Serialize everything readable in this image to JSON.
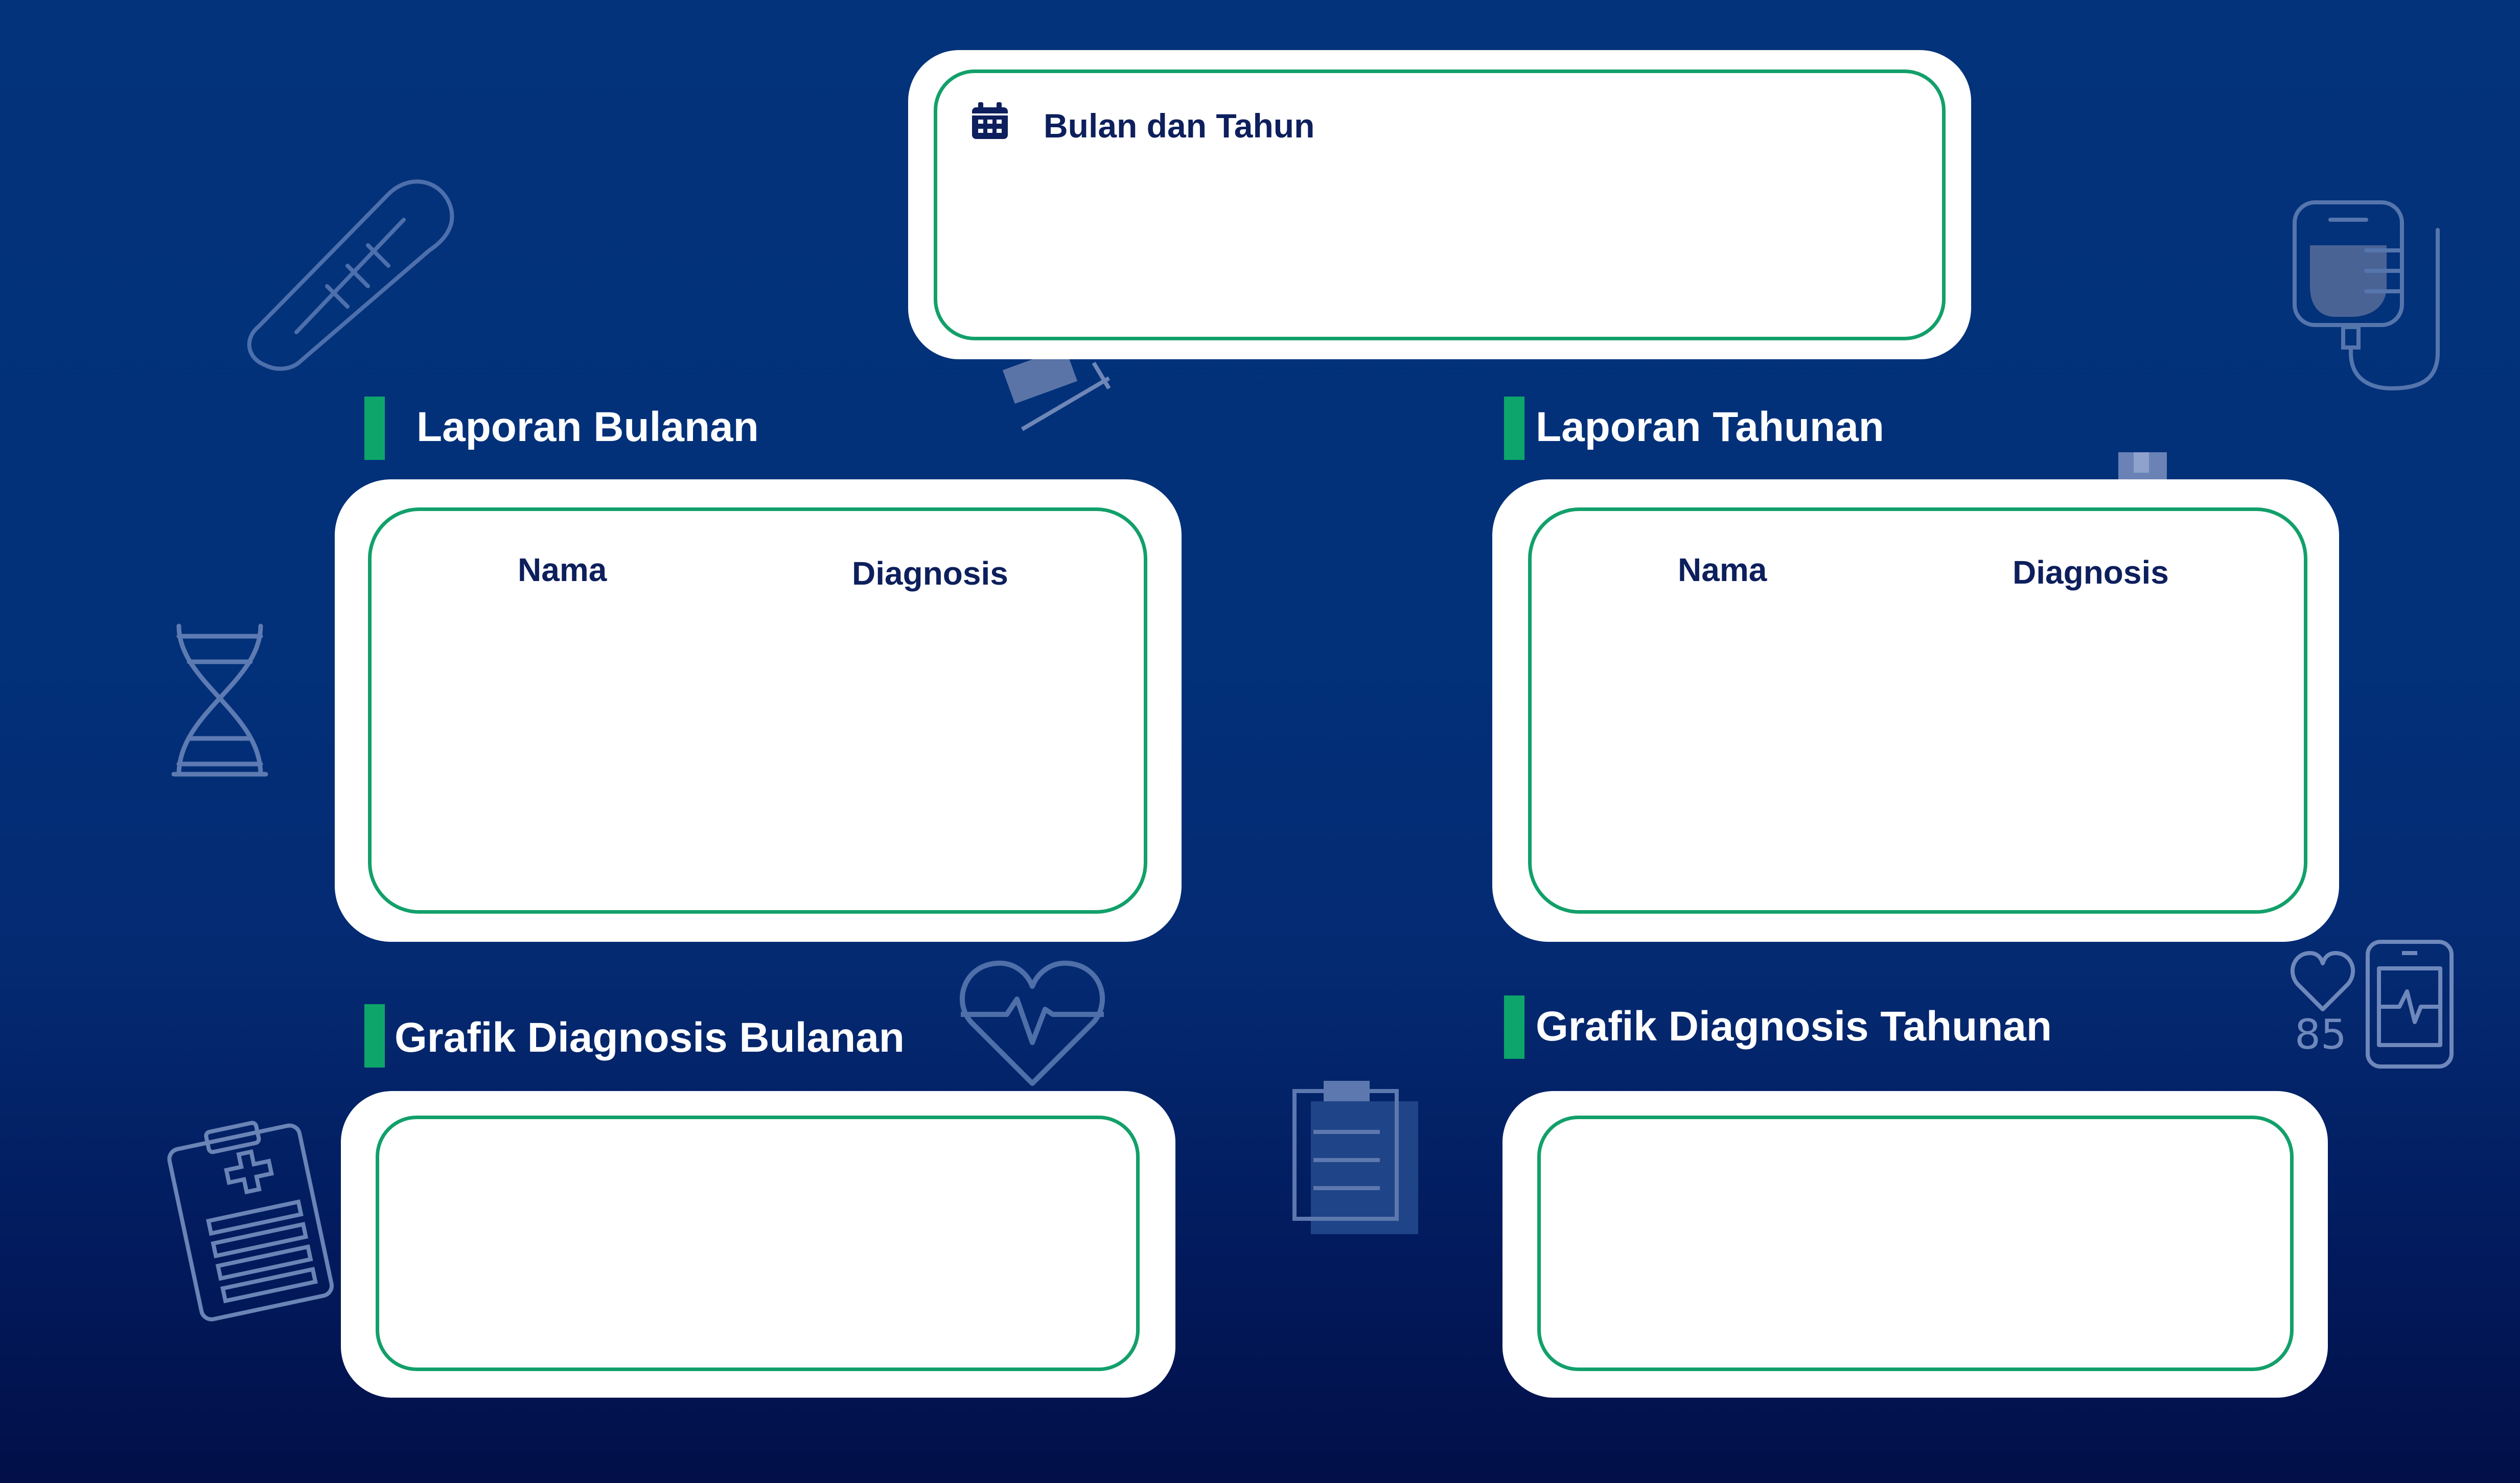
{
  "filter": {
    "label": "Bulan dan Tahun",
    "icon": "calendar-icon"
  },
  "sections": {
    "laporan_bulanan": {
      "title": "Laporan Bulanan",
      "columns": [
        "Nama",
        "Diagnosis"
      ],
      "rows": []
    },
    "laporan_tahunan": {
      "title": "Laporan Tahunan",
      "columns": [
        "Nama",
        "Diagnosis"
      ],
      "rows": []
    },
    "grafik_bulanan": {
      "title": "Grafik Diagnosis Bulanan"
    },
    "grafik_tahunan": {
      "title": "Grafik Diagnosis Tahunan"
    }
  },
  "background_icons": [
    "thermometer-icon",
    "iv-bag-icon",
    "dna-icon",
    "heart-pulse-icon",
    "clipboard-icon",
    "document-icon",
    "heart-rate-monitor-icon",
    "heart-icon"
  ],
  "decor_text": {
    "heart_rate_value": "85"
  },
  "colors": {
    "background_top": "#03337a",
    "background_bottom": "#020f48",
    "accent_green": "#12a06a",
    "text_dark": "#0d1f5c",
    "card": "#ffffff"
  }
}
